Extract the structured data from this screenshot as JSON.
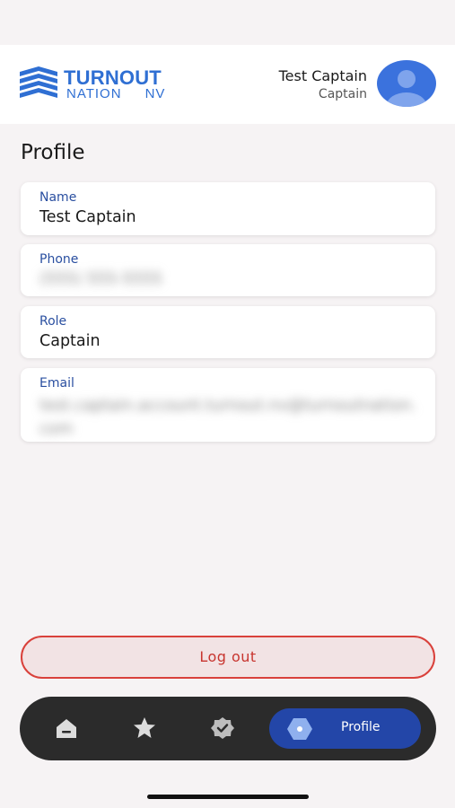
{
  "header": {
    "logo": {
      "line1": "TURNOUT",
      "line2a": "NATION",
      "line2b": "NV"
    },
    "user_name": "Test Captain",
    "user_role": "Captain"
  },
  "page": {
    "title": "Profile"
  },
  "fields": {
    "name": {
      "label": "Name",
      "value": "Test Captain"
    },
    "phone": {
      "label": "Phone",
      "value": "(555) 555-5555"
    },
    "role": {
      "label": "Role",
      "value": "Captain"
    },
    "email": {
      "label": "Email",
      "value": "test.captain.account.turnout.nv@turnoutnation.com"
    }
  },
  "actions": {
    "logout_label": "Log out"
  },
  "nav": {
    "items": [
      {
        "icon": "home-icon"
      },
      {
        "icon": "star-icon"
      },
      {
        "icon": "badge-check-icon"
      },
      {
        "icon": "profile-hex-icon",
        "label": "Profile",
        "active": true
      }
    ]
  },
  "colors": {
    "brand_blue": "#2f6fd3",
    "label_blue": "#2a4fa0",
    "nav_active": "#2346a8",
    "nav_bg": "#2b2b2b",
    "logout_red": "#d9413b"
  }
}
